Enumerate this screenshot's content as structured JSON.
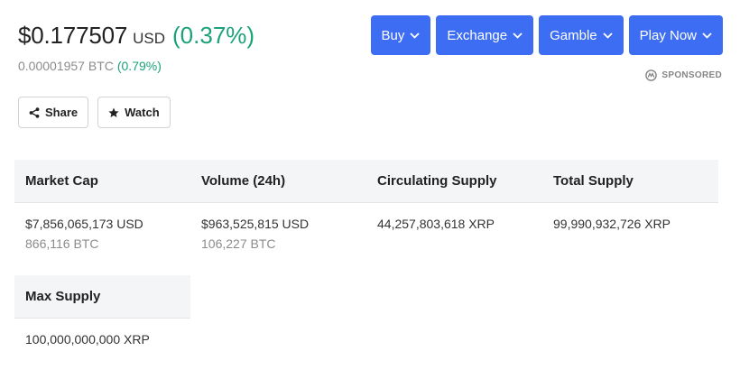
{
  "price": {
    "usd_value": "$0.177507",
    "usd_unit": "USD",
    "usd_change": "(0.37%)",
    "btc_value": "0.00001957 BTC",
    "btc_change": "(0.79%)"
  },
  "actions": {
    "share_label": "Share",
    "watch_label": "Watch"
  },
  "promo_buttons": [
    {
      "label": "Buy"
    },
    {
      "label": "Exchange"
    },
    {
      "label": "Gamble"
    },
    {
      "label": "Play Now"
    }
  ],
  "sponsored_label": "SPONSORED",
  "stats": [
    {
      "header": "Market Cap",
      "primary": "$7,856,065,173 USD",
      "secondary": "866,116 BTC"
    },
    {
      "header": "Volume (24h)",
      "primary": "$963,525,815 USD",
      "secondary": "106,227 BTC"
    },
    {
      "header": "Circulating Supply",
      "primary": "44,257,803,618 XRP",
      "secondary": ""
    },
    {
      "header": "Total Supply",
      "primary": "99,990,932,726 XRP",
      "secondary": ""
    },
    {
      "header": "Max Supply",
      "primary": "100,000,000,000 XRP",
      "secondary": ""
    }
  ],
  "colors": {
    "positive": "#1ba27a",
    "accent_button": "#3d6df2",
    "header_bg": "#f4f5f7"
  },
  "icons": {
    "share": "share-icon",
    "watch": "star-icon",
    "dropdown": "chevron-down-icon",
    "sponsored": "sponsored-logo-icon"
  }
}
